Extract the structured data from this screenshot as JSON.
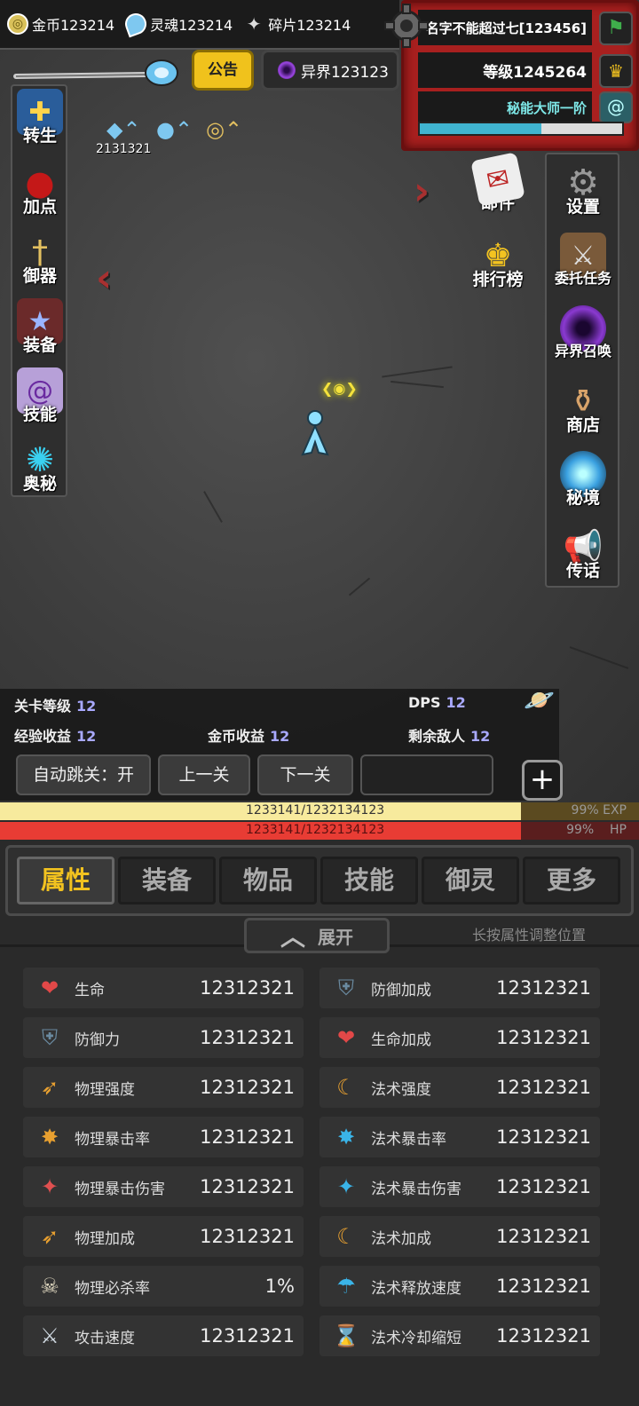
{
  "resources": {
    "gold": "金币123214",
    "soul": "灵魂123214",
    "shard": "碎片123214"
  },
  "player": {
    "name": "名字不能超过七[123456]",
    "level": "等级1245264",
    "title": "秘能大师一阶",
    "progress": 0.6
  },
  "top": {
    "notice": "公告",
    "otherworld": "异界123123"
  },
  "left_menu": [
    {
      "label": "转生",
      "icon": "rebirth-icon"
    },
    {
      "label": "加点",
      "icon": "blood-drop-icon"
    },
    {
      "label": "御器",
      "icon": "sword-icon"
    },
    {
      "label": "装备",
      "icon": "shield-icon"
    },
    {
      "label": "技能",
      "icon": "scroll-icon"
    },
    {
      "label": "奥秘",
      "icon": "vortex-icon"
    }
  ],
  "right_menu": [
    {
      "label": "邮件",
      "icon": "mail-icon"
    },
    {
      "label": "设置",
      "icon": "gear-icon"
    },
    {
      "label": "排行榜",
      "icon": "trophy-icon"
    },
    {
      "label": "委托任务",
      "icon": "quest-board-icon"
    },
    {
      "label": "异界召唤",
      "icon": "portal-icon"
    },
    {
      "label": "商店",
      "icon": "shop-icon"
    },
    {
      "label": "秘境",
      "icon": "realm-icon"
    },
    {
      "label": "传话",
      "icon": "horn-icon"
    }
  ],
  "buff_value": "2131321",
  "stats": {
    "stage_level_label": "关卡等级",
    "stage_level": "12",
    "dps_label": "DPS",
    "dps": "12",
    "exp_gain_label": "经验收益",
    "exp_gain": "12",
    "gold_gain_label": "金币收益",
    "gold_gain": "12",
    "enemies_label": "剩余敌人",
    "enemies": "12",
    "auto_skip": "自动跳关：开",
    "prev": "上一关",
    "next": "下一关"
  },
  "bars": {
    "exp_text": "1233141/1232134123",
    "exp_pct": "99%",
    "exp_label": "EXP",
    "hp_text": "1233141/1232134123",
    "hp_pct": "99%",
    "hp_label": "HP"
  },
  "tabs": [
    "属性",
    "装备",
    "物品",
    "技能",
    "御灵",
    "更多"
  ],
  "expand_label": "展开",
  "hint": "长按属性调整位置",
  "attributes": [
    {
      "label": "生命",
      "value": "12312321",
      "icon": "heart-icon"
    },
    {
      "label": "防御加成",
      "value": "12312321",
      "icon": "shield-plus-icon"
    },
    {
      "label": "防御力",
      "value": "12312321",
      "icon": "shield-icon"
    },
    {
      "label": "生命加成",
      "value": "12312321",
      "icon": "heart-plus-icon"
    },
    {
      "label": "物理强度",
      "value": "12312321",
      "icon": "phys-power-icon"
    },
    {
      "label": "法术强度",
      "value": "12312321",
      "icon": "magic-power-icon"
    },
    {
      "label": "物理暴击率",
      "value": "12312321",
      "icon": "phys-crit-icon"
    },
    {
      "label": "法术暴击率",
      "value": "12312321",
      "icon": "magic-crit-icon"
    },
    {
      "label": "物理暴击伤害",
      "value": "12312321",
      "icon": "phys-crit-damage-icon"
    },
    {
      "label": "法术暴击伤害",
      "value": "12312321",
      "icon": "magic-crit-damage-icon"
    },
    {
      "label": "物理加成",
      "value": "12312321",
      "icon": "phys-bonus-icon"
    },
    {
      "label": "法术加成",
      "value": "12312321",
      "icon": "magic-bonus-icon"
    },
    {
      "label": "物理必杀率",
      "value": "1%",
      "icon": "skull-icon"
    },
    {
      "label": "法术释放速度",
      "value": "12312321",
      "icon": "cast-speed-icon"
    },
    {
      "label": "攻击速度",
      "value": "12312321",
      "icon": "attack-speed-icon"
    },
    {
      "label": "法术冷却缩短",
      "value": "12312321",
      "icon": "hourglass-icon"
    }
  ],
  "colors": {
    "accent_gold": "#f2c21f",
    "player_panel": "#a8201f",
    "exp_fill": "#f7ea9d",
    "hp_fill": "#e83c34",
    "title_text": "#7ee8e8"
  }
}
